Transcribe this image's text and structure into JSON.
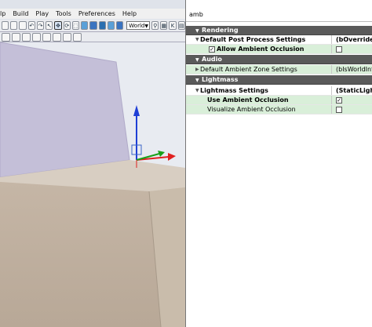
{
  "window": {
    "title_fragment": "lp"
  },
  "menubar": {
    "items": [
      "Build",
      "Play",
      "Tools",
      "Preferences",
      "Help"
    ]
  },
  "toolbar": {
    "coord_space": "World",
    "undo_icon": "↶",
    "redo_icon": "↷",
    "kismet_letter": "K"
  },
  "search": {
    "value": "amb"
  },
  "categories": {
    "rendering": "Rendering",
    "audio": "Audio",
    "lightmass": "Lightmass"
  },
  "properties": {
    "default_pp": {
      "label": "Default Post Process Settings",
      "value": "(bOverride_"
    },
    "allow_ao": {
      "label": "Allow Ambient Occlusion",
      "checked": true
    },
    "ambient_zone": {
      "label": "Default Ambient Zone Settings",
      "value": "(bIsWorldInfo="
    },
    "lightmass_settings": {
      "label": "Lightmass Settings",
      "value": "(StaticLightin"
    },
    "use_ao": {
      "label": "Use Ambient Occlusion",
      "checked": true
    },
    "visualize_ao": {
      "label": "Visualize Ambient Occlusion",
      "checked": false
    }
  },
  "colors": {
    "category_bg": "#5a5a5a",
    "highlight_row": "#d9efd9",
    "gizmo_z": "#1f3fd6",
    "gizmo_x": "#e02020",
    "gizmo_y": "#18a018"
  }
}
